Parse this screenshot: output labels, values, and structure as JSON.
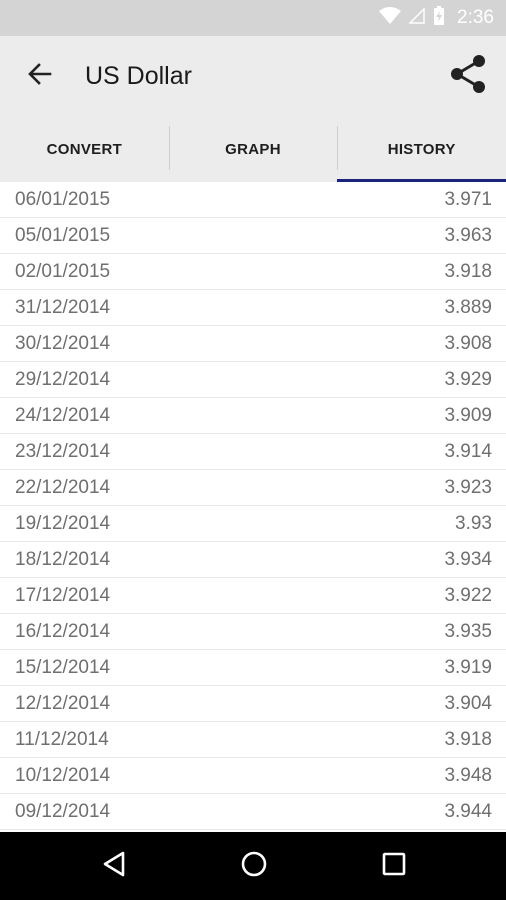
{
  "status_bar": {
    "time": "2:36",
    "icons": [
      "wifi-icon",
      "cell-signal-icon",
      "battery-charging-icon"
    ]
  },
  "app_bar": {
    "title": "US Dollar",
    "back_icon": "arrow-left-icon",
    "share_icon": "share-icon"
  },
  "tabs": [
    {
      "label": "CONVERT",
      "active": false
    },
    {
      "label": "GRAPH",
      "active": false
    },
    {
      "label": "HISTORY",
      "active": true
    }
  ],
  "history": [
    {
      "date": "06/01/2015",
      "rate": "3.971"
    },
    {
      "date": "05/01/2015",
      "rate": "3.963"
    },
    {
      "date": "02/01/2015",
      "rate": "3.918"
    },
    {
      "date": "31/12/2014",
      "rate": "3.889"
    },
    {
      "date": "30/12/2014",
      "rate": "3.908"
    },
    {
      "date": "29/12/2014",
      "rate": "3.929"
    },
    {
      "date": "24/12/2014",
      "rate": "3.909"
    },
    {
      "date": "23/12/2014",
      "rate": "3.914"
    },
    {
      "date": "22/12/2014",
      "rate": "3.923"
    },
    {
      "date": "19/12/2014",
      "rate": "3.93"
    },
    {
      "date": "18/12/2014",
      "rate": "3.934"
    },
    {
      "date": "17/12/2014",
      "rate": "3.922"
    },
    {
      "date": "16/12/2014",
      "rate": "3.935"
    },
    {
      "date": "15/12/2014",
      "rate": "3.919"
    },
    {
      "date": "12/12/2014",
      "rate": "3.904"
    },
    {
      "date": "11/12/2014",
      "rate": "3.918"
    },
    {
      "date": "10/12/2014",
      "rate": "3.948"
    },
    {
      "date": "09/12/2014",
      "rate": "3.944"
    }
  ],
  "nav_bar": {
    "icons": [
      "nav-back-icon",
      "home-icon",
      "recents-icon"
    ]
  },
  "colors": {
    "app_bar_bg": "#ececec",
    "tab_indicator": "#1b237e",
    "status_bar_bg": "#d4d4d4",
    "nav_bar_bg": "#000000",
    "row_text": "#6f6f6f"
  }
}
